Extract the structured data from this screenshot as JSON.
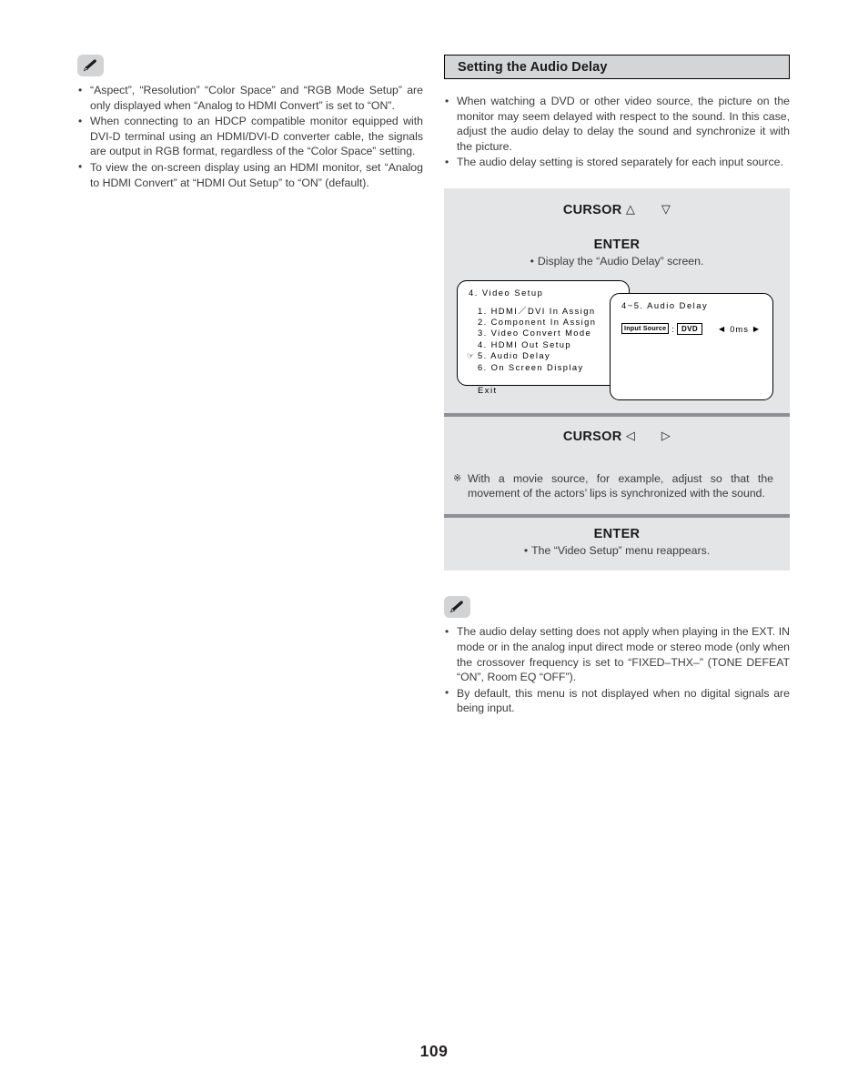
{
  "page": {
    "number": "109"
  },
  "left_column": {
    "icon": "pencil-note-icon",
    "notes": [
      "“Aspect”, “Resolution” “Color Space” and “RGB Mode Setup” are only displayed when “Analog to HDMI Convert” is set to “ON”.",
      "When connecting to an HDCP compatible monitor equipped with DVI-D terminal using an HDMI/DVI-D converter cable, the signals are output in RGB format, regardless of the “Color Space” setting.",
      "To view the on-screen display using an HDMI monitor, set “Analog to HDMI Convert” at “HDMI Out Setup” to “ON” (default)."
    ]
  },
  "right_column": {
    "section_title": "Setting the Audio Delay",
    "intro_bullets": [
      "When watching a DVD or other video source, the picture on the monitor may seem delayed with respect to the sound. In this case, adjust the audio delay to delay the sound and synchronize it with the picture.",
      "The audio delay setting is stored separately for each input source."
    ],
    "procedure": {
      "step1": {
        "key_label": "CURSOR",
        "icon_up": "triangle-up-icon",
        "icon_down": "triangle-down-icon",
        "glyph_up": "△",
        "glyph_down": "▽"
      },
      "step2": {
        "key_label": "ENTER",
        "note": "Display the “Audio Delay” screen."
      },
      "step3": {
        "key_label": "CURSOR",
        "icon_left": "triangle-left-icon",
        "icon_right": "triangle-right-icon",
        "glyph_left": "◁",
        "glyph_right": "▷",
        "note_mark": "※",
        "note": "With a movie source, for example, adjust so that the movement of the actors’ lips is synchronized with the sound."
      },
      "step4": {
        "key_label": "ENTER",
        "note": "The “Video Setup” menu reappears."
      }
    },
    "osd": {
      "video_setup": {
        "title": "4. Video Setup",
        "items": [
          {
            "label": "1. HDMI／DVI In Assign",
            "selected": false
          },
          {
            "label": "2. Component In Assign",
            "selected": false
          },
          {
            "label": "3. Video Convert Mode",
            "selected": false
          },
          {
            "label": "4. HDMI Out Setup",
            "selected": false
          },
          {
            "label": "5. Audio Delay",
            "selected": true
          },
          {
            "label": "6. On Screen Display",
            "selected": false
          }
        ],
        "cursor_glyph": "☞",
        "exit_label": "Exit"
      },
      "audio_delay": {
        "title": "4−5. Audio Delay",
        "field_label": "Input Source",
        "separator": ":",
        "field_value": "DVD",
        "delay_value": "0ms",
        "arrow_left": "◀",
        "arrow_right": "▶"
      }
    },
    "bottom_notes": {
      "icon": "pencil-note-icon",
      "notes": [
        "The audio delay setting does not apply when playing in the EXT. IN mode or in the analog input direct mode or stereo mode (only when the crossover frequency is set to “FIXED–THX–” (TONE DEFEAT “ON”, Room EQ “OFF”).",
        "By default, this menu is not displayed when no digital signals are being input."
      ]
    }
  },
  "colors": {
    "panel_gray": "#e4e5e7",
    "divider_gray": "#8d8f94",
    "header_gray": "#d4d5d7",
    "badge_gray": "#d2d3d5",
    "text": "#3b3b3d"
  }
}
